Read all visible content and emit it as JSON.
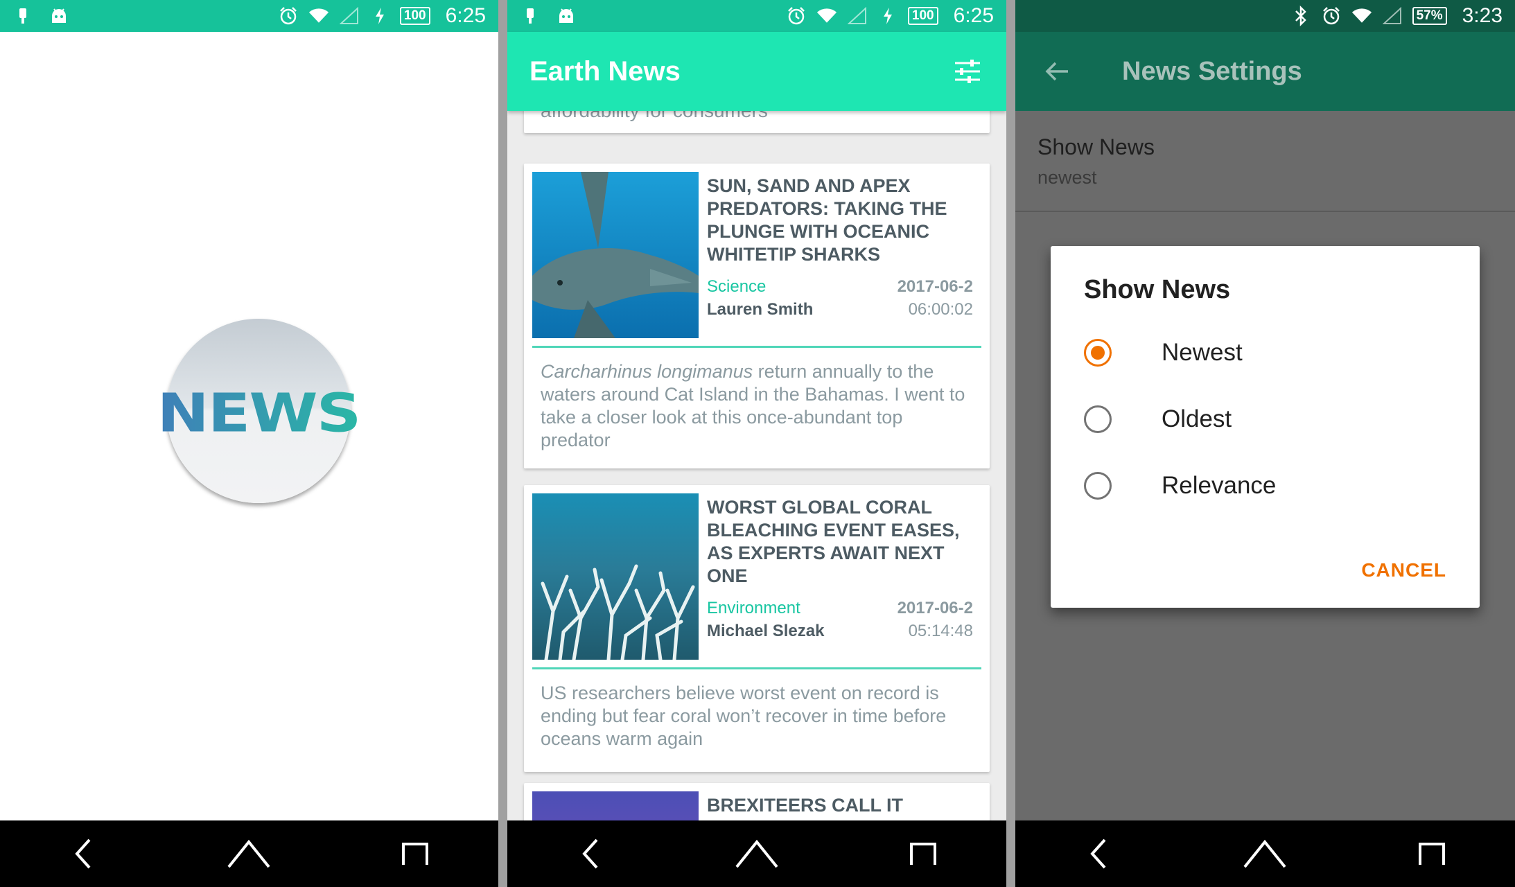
{
  "screen1": {
    "statusbar": {
      "battery": "100",
      "time": "6:25",
      "bg_color": "#16c29a"
    },
    "logo": {
      "text": "NEWS"
    }
  },
  "screen2": {
    "statusbar": {
      "battery": "100",
      "time": "6:25",
      "bg_color": "#16c29a"
    },
    "appbar": {
      "title": "Earth News",
      "bg_color": "#1ee6b2",
      "action_icon": "filter-settings-icon"
    },
    "previous_card_text": "affordability for consumers",
    "articles": [
      {
        "title": "SUN, SAND AND APEX PREDATORS: TAKING THE PLUNGE WITH OCEANIC WHITETIP SHARKS",
        "category": "Science",
        "author": "Lauren Smith",
        "date": "2017-06-2",
        "time": "06:00:02",
        "desc_italic": "Carcharhinus longimanus",
        "desc": " return annually to the waters around Cat Island in the Bahamas. I went to take a closer look at this once-abundant top predator"
      },
      {
        "title": "WORST GLOBAL CORAL BLEACHING EVENT EASES, AS EXPERTS AWAIT NEXT ONE",
        "category": "Environment",
        "author": "Michael Slezak",
        "date": "2017-06-2",
        "time": "05:14:48",
        "desc": "US researchers believe worst event on record is ending but fear coral won’t recover in time before oceans warm again"
      },
      {
        "title": "BREXITEERS CALL IT"
      }
    ]
  },
  "screen3": {
    "statusbar": {
      "battery": "57%",
      "time": "3:23",
      "bg_color": "#0f5a45"
    },
    "appbar": {
      "title": "News Settings",
      "bg_color": "#116c54"
    },
    "preference": {
      "title": "Show News",
      "summary": "newest"
    },
    "dialog": {
      "title": "Show News",
      "options": [
        {
          "label": "Newest",
          "selected": true
        },
        {
          "label": "Oldest",
          "selected": false
        },
        {
          "label": "Relevance",
          "selected": false
        }
      ],
      "cancel_label": "CANCEL",
      "accent_color": "#f07100"
    }
  }
}
